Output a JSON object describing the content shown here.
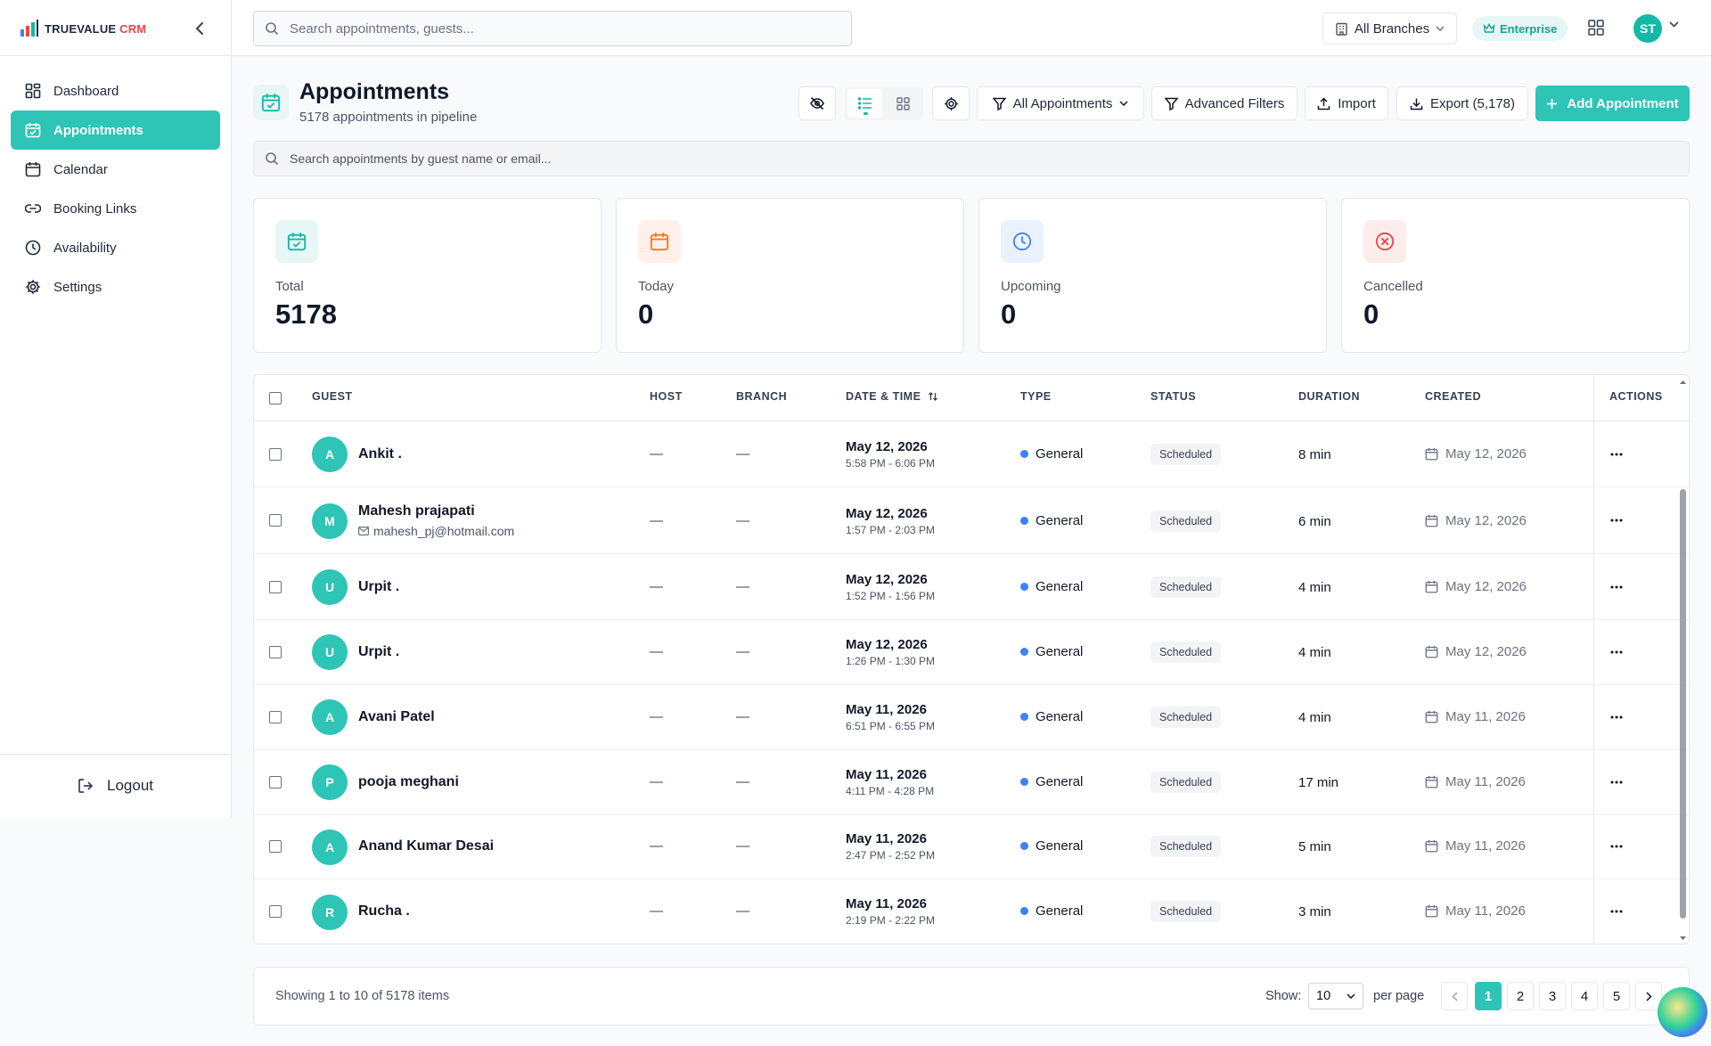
{
  "app": {
    "logo_text": "TRUEVALUE ",
    "logo_accent": "CRM"
  },
  "sidebar": {
    "items": [
      {
        "label": "Dashboard",
        "icon": "dashboard-icon",
        "active": false
      },
      {
        "label": "Appointments",
        "icon": "calendar-check-icon",
        "active": true
      },
      {
        "label": "Calendar",
        "icon": "calendar-icon",
        "active": false
      },
      {
        "label": "Booking Links",
        "icon": "link-icon",
        "active": false
      },
      {
        "label": "Availability",
        "icon": "clock-icon",
        "active": false
      },
      {
        "label": "Settings",
        "icon": "gear-icon",
        "active": false
      }
    ],
    "logout_label": "Logout"
  },
  "topbar": {
    "search_placeholder": "Search appointments, guests...",
    "branches_label": "All Branches",
    "plan_badge": "Enterprise",
    "avatar_initials": "ST"
  },
  "header": {
    "title": "Appointments",
    "subtitle": "5178 appointments in pipeline",
    "filter_label": "All Appointments",
    "advanced_filters_label": "Advanced Filters",
    "import_label": "Import",
    "export_label": "Export (5,178)",
    "add_label": "Add Appointment",
    "search_placeholder": "Search appointments by guest name or email..."
  },
  "stats": [
    {
      "label": "Total",
      "value": "5178",
      "icon": "calendar-check-icon",
      "color": "#14b8a6",
      "bg": "#e6f7f5"
    },
    {
      "label": "Today",
      "value": "0",
      "icon": "calendar-icon",
      "color": "#f97316",
      "bg": "#fff1ea"
    },
    {
      "label": "Upcoming",
      "value": "0",
      "icon": "clock-icon",
      "color": "#3b82f6",
      "bg": "#eaf2fe"
    },
    {
      "label": "Cancelled",
      "value": "0",
      "icon": "x-circle-icon",
      "color": "#ef4444",
      "bg": "#fdecec"
    }
  ],
  "table": {
    "columns": [
      "GUEST",
      "HOST",
      "BRANCH",
      "DATE & TIME",
      "TYPE",
      "STATUS",
      "DURATION",
      "CREATED",
      "ACTIONS"
    ],
    "rows": [
      {
        "initial": "A",
        "name": "Ankit .",
        "email": "",
        "host": "—",
        "branch": "—",
        "date": "May 12, 2026",
        "time": "5:58 PM - 6:06 PM",
        "type": "General",
        "status": "Scheduled",
        "duration": "8 min",
        "created": "May 12, 2026"
      },
      {
        "initial": "M",
        "name": "Mahesh prajapati",
        "email": "mahesh_pj@hotmail.com",
        "host": "—",
        "branch": "—",
        "date": "May 12, 2026",
        "time": "1:57 PM - 2:03 PM",
        "type": "General",
        "status": "Scheduled",
        "duration": "6 min",
        "created": "May 12, 2026"
      },
      {
        "initial": "U",
        "name": "Urpit .",
        "email": "",
        "host": "—",
        "branch": "—",
        "date": "May 12, 2026",
        "time": "1:52 PM - 1:56 PM",
        "type": "General",
        "status": "Scheduled",
        "duration": "4 min",
        "created": "May 12, 2026"
      },
      {
        "initial": "U",
        "name": "Urpit .",
        "email": "",
        "host": "—",
        "branch": "—",
        "date": "May 12, 2026",
        "time": "1:26 PM - 1:30 PM",
        "type": "General",
        "status": "Scheduled",
        "duration": "4 min",
        "created": "May 12, 2026"
      },
      {
        "initial": "A",
        "name": "Avani Patel",
        "email": "",
        "host": "—",
        "branch": "—",
        "date": "May 11, 2026",
        "time": "6:51 PM - 6:55 PM",
        "type": "General",
        "status": "Scheduled",
        "duration": "4 min",
        "created": "May 11, 2026"
      },
      {
        "initial": "P",
        "name": "pooja meghani",
        "email": "",
        "host": "—",
        "branch": "—",
        "date": "May 11, 2026",
        "time": "4:11 PM - 4:28 PM",
        "type": "General",
        "status": "Scheduled",
        "duration": "17 min",
        "created": "May 11, 2026"
      },
      {
        "initial": "A",
        "name": "Anand Kumar Desai",
        "email": "",
        "host": "—",
        "branch": "—",
        "date": "May 11, 2026",
        "time": "2:47 PM - 2:52 PM",
        "type": "General",
        "status": "Scheduled",
        "duration": "5 min",
        "created": "May 11, 2026"
      },
      {
        "initial": "R",
        "name": "Rucha .",
        "email": "",
        "host": "—",
        "branch": "—",
        "date": "May 11, 2026",
        "time": "2:19 PM - 2:22 PM",
        "type": "General",
        "status": "Scheduled",
        "duration": "3 min",
        "created": "May 11, 2026"
      }
    ]
  },
  "pagination": {
    "showing": "Showing 1 to 10 of 5178 items",
    "show_label": "Show:",
    "per_page_value": "10",
    "per_page_label": "per page",
    "pages": [
      "1",
      "2",
      "3",
      "4",
      "5"
    ],
    "current_page": "1"
  },
  "colors": {
    "accent": "#2ec4b6",
    "type_dot": "#3b82f6"
  }
}
